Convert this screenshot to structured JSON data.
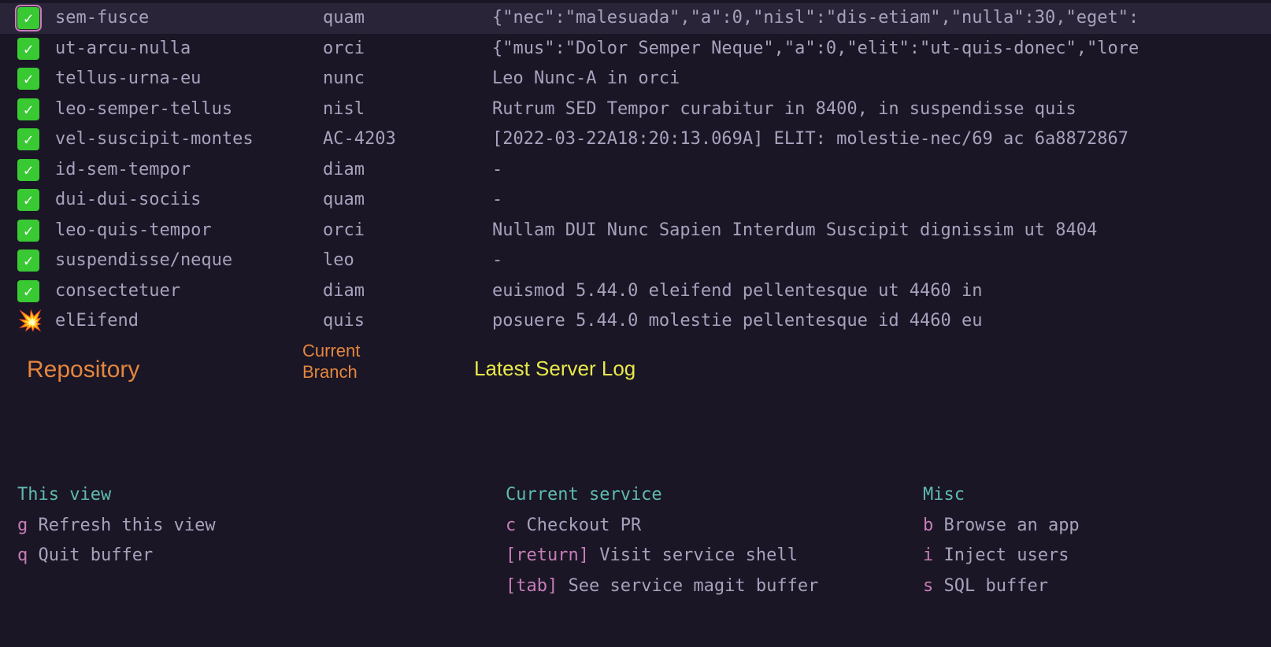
{
  "rows": [
    {
      "status": "ok",
      "selected": true,
      "cursor": true,
      "repo": "sem-fusce",
      "branch": "quam",
      "log": "{\"nec\":\"malesuada\",\"a\":0,\"nisl\":\"dis-etiam\",\"nulla\":30,\"eget\":"
    },
    {
      "status": "ok",
      "selected": false,
      "cursor": false,
      "repo": "ut-arcu-nulla",
      "branch": "orci",
      "log": "{\"mus\":\"Dolor Semper Neque\",\"a\":0,\"elit\":\"ut-quis-donec\",\"lore"
    },
    {
      "status": "ok",
      "selected": false,
      "cursor": false,
      "repo": "tellus-urna-eu",
      "branch": "nunc",
      "log": "Leo Nunc-A in orci"
    },
    {
      "status": "ok",
      "selected": false,
      "cursor": false,
      "repo": "leo-semper-tellus",
      "branch": "nisl",
      "log": "Rutrum SED Tempor curabitur in 8400, in suspendisse quis"
    },
    {
      "status": "ok",
      "selected": false,
      "cursor": false,
      "repo": "vel-suscipit-montes",
      "branch": "AC-4203",
      "log": "[2022-03-22A18:20:13.069A]  ELIT: molestie-nec/69 ac 6a8872867"
    },
    {
      "status": "ok",
      "selected": false,
      "cursor": false,
      "repo": "id-sem-tempor",
      "branch": "diam",
      "log": "-"
    },
    {
      "status": "ok",
      "selected": false,
      "cursor": false,
      "repo": "dui-dui-sociis",
      "branch": "quam",
      "log": "-"
    },
    {
      "status": "ok",
      "selected": false,
      "cursor": false,
      "repo": "leo-quis-tempor",
      "branch": "orci",
      "log": "Nullam DUI Nunc Sapien Interdum Suscipit dignissim ut 8404"
    },
    {
      "status": "ok",
      "selected": false,
      "cursor": false,
      "repo": "suspendisse/neque",
      "branch": "leo",
      "log": "-"
    },
    {
      "status": "ok",
      "selected": false,
      "cursor": false,
      "repo": "consectetuer",
      "branch": "diam",
      "log": "euismod 5.44.0 eleifend pellentesque ut 4460 in"
    },
    {
      "status": "error",
      "selected": false,
      "cursor": false,
      "repo": "elEifend",
      "branch": "quis",
      "log": "posuere 5.44.0 molestie pellentesque id 4460 eu"
    }
  ],
  "headers": {
    "repo": "Repository",
    "branch": "Current\nBranch",
    "log": "Latest Server Log"
  },
  "help": {
    "col1": {
      "title": "This view",
      "items": [
        {
          "key": "g",
          "label": "Refresh this view"
        },
        {
          "key": "q",
          "label": "Quit buffer"
        }
      ]
    },
    "col2": {
      "title": "Current service",
      "items": [
        {
          "key": "c",
          "label": "Checkout PR"
        },
        {
          "key": "[return]",
          "label": "Visit service shell"
        },
        {
          "key": "[tab]",
          "label": "See service magit buffer"
        }
      ]
    },
    "col3": {
      "title": "Misc",
      "items": [
        {
          "key": "b",
          "label": "Browse an app"
        },
        {
          "key": "i",
          "label": "Inject users"
        },
        {
          "key": "s",
          "label": "SQL buffer"
        }
      ]
    }
  },
  "icons": {
    "check_glyph": "✓",
    "error_glyph": "💥"
  }
}
